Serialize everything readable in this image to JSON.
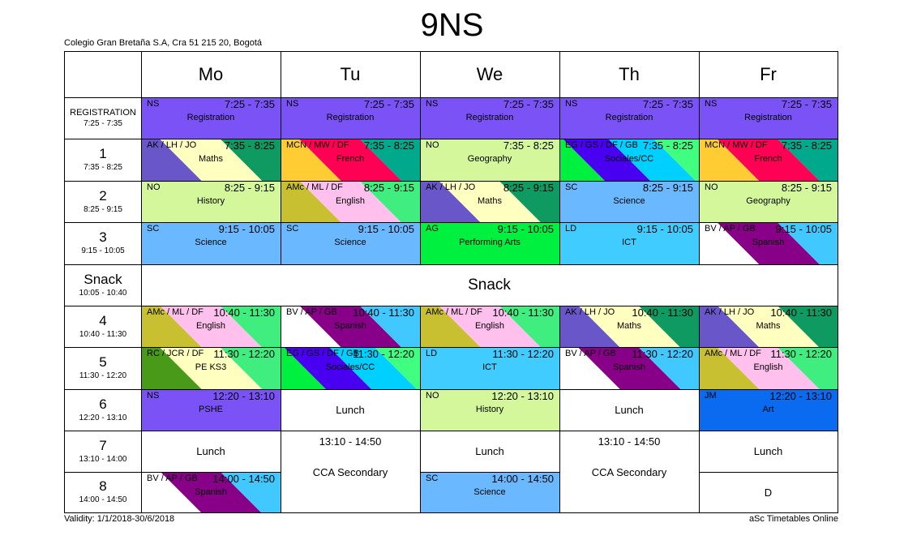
{
  "title": "9NS",
  "school": "Colegio Gran Bretaña S.A, Cra 51 215 20, Bogotá",
  "validity": "Validity: 1/1/2018-30/6/2018",
  "credit": "aSc Timetables Online",
  "days": [
    "Mo",
    "Tu",
    "We",
    "Th",
    "Fr"
  ],
  "periods": [
    {
      "name": "REGISTRATION",
      "time": "7:25 - 7:35"
    },
    {
      "name": "1",
      "time": "7:35 - 8:25"
    },
    {
      "name": "2",
      "time": "8:25 - 9:15"
    },
    {
      "name": "3",
      "time": "9:15 - 10:05"
    },
    {
      "name": "Snack",
      "time": "10:05 - 10:40"
    },
    {
      "name": "4",
      "time": "10:40 - 11:30"
    },
    {
      "name": "5",
      "time": "11:30 - 12:20"
    },
    {
      "name": "6",
      "time": "12:20 - 13:10"
    },
    {
      "name": "7",
      "time": "13:10 - 14:00"
    },
    {
      "name": "8",
      "time": "14:00 - 14:50"
    }
  ],
  "snack_label": "Snack",
  "cells": [
    {
      "day": 0,
      "row": 0,
      "span": 1,
      "kind": "lesson",
      "teacher": "NS",
      "time": "7:25 - 7:35",
      "subject": "Registration",
      "colors": [
        "#7b52f6"
      ]
    },
    {
      "day": 1,
      "row": 0,
      "span": 1,
      "kind": "lesson",
      "teacher": "NS",
      "time": "7:25 - 7:35",
      "subject": "Registration",
      "colors": [
        "#7b52f6"
      ]
    },
    {
      "day": 2,
      "row": 0,
      "span": 1,
      "kind": "lesson",
      "teacher": "NS",
      "time": "7:25 - 7:35",
      "subject": "Registration",
      "colors": [
        "#7b52f6"
      ]
    },
    {
      "day": 3,
      "row": 0,
      "span": 1,
      "kind": "lesson",
      "teacher": "NS",
      "time": "7:25 - 7:35",
      "subject": "Registration",
      "colors": [
        "#7b52f6"
      ]
    },
    {
      "day": 4,
      "row": 0,
      "span": 1,
      "kind": "lesson",
      "teacher": "NS",
      "time": "7:25 - 7:35",
      "subject": "Registration",
      "colors": [
        "#7b52f6"
      ]
    },
    {
      "day": 0,
      "row": 1,
      "span": 1,
      "kind": "lesson",
      "teacher": "AK / LH / JO",
      "time": "7:35 - 8:25",
      "subject": "Maths",
      "colors": [
        "#6957c9",
        "#ffffc0",
        "#0f9a62"
      ]
    },
    {
      "day": 1,
      "row": 1,
      "span": 1,
      "kind": "lesson",
      "teacher": "MCN / MW / DF",
      "time": "7:35 - 8:25",
      "subject": "French",
      "colors": [
        "#ffcc33",
        "#ff0055",
        "#00a88c"
      ]
    },
    {
      "day": 2,
      "row": 1,
      "span": 1,
      "kind": "lesson",
      "teacher": "NO",
      "time": "7:35 - 8:25",
      "subject": "Geography",
      "colors": [
        "#d4f79c"
      ]
    },
    {
      "day": 3,
      "row": 1,
      "span": 1,
      "kind": "lesson",
      "teacher": "EG / GS / DF / GB",
      "time": "7:35 - 8:25",
      "subject": "Sociales/CC",
      "colors": [
        "#00f040",
        "#4a00f0",
        "#00d0ff",
        "#40ff80"
      ]
    },
    {
      "day": 4,
      "row": 1,
      "span": 1,
      "kind": "lesson",
      "teacher": "MCN / MW / DF",
      "time": "7:35 - 8:25",
      "subject": "French",
      "colors": [
        "#ffcc33",
        "#ff0055",
        "#00a88c"
      ]
    },
    {
      "day": 0,
      "row": 2,
      "span": 1,
      "kind": "lesson",
      "teacher": "NO",
      "time": "8:25 - 9:15",
      "subject": "History",
      "colors": [
        "#d4f79c"
      ]
    },
    {
      "day": 1,
      "row": 2,
      "span": 1,
      "kind": "lesson",
      "teacher": "AMc / ML / DF",
      "time": "8:25 - 9:15",
      "subject": "English",
      "colors": [
        "#c8c030",
        "#ffc0ee",
        "#40ee80"
      ]
    },
    {
      "day": 2,
      "row": 2,
      "span": 1,
      "kind": "lesson",
      "teacher": "AK / LH / JO",
      "time": "8:25 - 9:15",
      "subject": "Maths",
      "colors": [
        "#6957c9",
        "#ffffc0",
        "#0f9a62"
      ]
    },
    {
      "day": 3,
      "row": 2,
      "span": 1,
      "kind": "lesson",
      "teacher": "SC",
      "time": "8:25 - 9:15",
      "subject": "Science",
      "colors": [
        "#6ab8ff"
      ]
    },
    {
      "day": 4,
      "row": 2,
      "span": 1,
      "kind": "lesson",
      "teacher": "NO",
      "time": "8:25 - 9:15",
      "subject": "Geography",
      "colors": [
        "#d4f79c"
      ]
    },
    {
      "day": 0,
      "row": 3,
      "span": 1,
      "kind": "lesson",
      "teacher": "SC",
      "time": "9:15 - 10:05",
      "subject": "Science",
      "colors": [
        "#6ab8ff"
      ]
    },
    {
      "day": 1,
      "row": 3,
      "span": 1,
      "kind": "lesson",
      "teacher": "SC",
      "time": "9:15 - 10:05",
      "subject": "Science",
      "colors": [
        "#6ab8ff"
      ]
    },
    {
      "day": 2,
      "row": 3,
      "span": 1,
      "kind": "lesson",
      "teacher": "AG",
      "time": "9:15 - 10:05",
      "subject": "Performing Arts",
      "colors": [
        "#00f040"
      ]
    },
    {
      "day": 3,
      "row": 3,
      "span": 1,
      "kind": "lesson",
      "teacher": "LD",
      "time": "9:15 - 10:05",
      "subject": "ICT",
      "colors": [
        "#40ccff"
      ]
    },
    {
      "day": 4,
      "row": 3,
      "span": 1,
      "kind": "lesson",
      "teacher": "BV / AP / GB",
      "time": "9:15 - 10:05",
      "subject": "Spanish",
      "colors": [
        "#ffffff",
        "#880088",
        "#40c8ff"
      ]
    },
    {
      "day": 0,
      "row": 5,
      "span": 1,
      "kind": "lesson",
      "teacher": "AMc / ML / DF",
      "time": "10:40 - 11:30",
      "subject": "English",
      "colors": [
        "#c8c030",
        "#ffc0ee",
        "#40ee80"
      ]
    },
    {
      "day": 1,
      "row": 5,
      "span": 1,
      "kind": "lesson",
      "teacher": "BV / AP / GB",
      "time": "10:40 - 11:30",
      "subject": "Spanish",
      "colors": [
        "#ffffff",
        "#880088",
        "#40c8ff"
      ]
    },
    {
      "day": 2,
      "row": 5,
      "span": 1,
      "kind": "lesson",
      "teacher": "AMc / ML / DF",
      "time": "10:40 - 11:30",
      "subject": "English",
      "colors": [
        "#c8c030",
        "#ffc0ee",
        "#40ee80"
      ]
    },
    {
      "day": 3,
      "row": 5,
      "span": 1,
      "kind": "lesson",
      "teacher": "AK / LH / JO",
      "time": "10:40 - 11:30",
      "subject": "Maths",
      "colors": [
        "#6957c9",
        "#ffffc0",
        "#0f9a62"
      ]
    },
    {
      "day": 4,
      "row": 5,
      "span": 1,
      "kind": "lesson",
      "teacher": "AK / LH / JO",
      "time": "10:40 - 11:30",
      "subject": "Maths",
      "colors": [
        "#6957c9",
        "#ffffc0",
        "#0f9a62"
      ]
    },
    {
      "day": 0,
      "row": 6,
      "span": 1,
      "kind": "lesson",
      "teacher": "RC / JCR / DF",
      "time": "11:30 - 12:20",
      "subject": "PE KS3",
      "colors": [
        "#4a9a1a",
        "#ffffc0",
        "#40ee80"
      ]
    },
    {
      "day": 1,
      "row": 6,
      "span": 1,
      "kind": "lesson",
      "teacher": "EG / GS / DF / GB",
      "time": "11:30 - 12:20",
      "subject": "Sociales/CC",
      "colors": [
        "#00f040",
        "#4a00f0",
        "#00d0ff",
        "#40ff80"
      ]
    },
    {
      "day": 2,
      "row": 6,
      "span": 1,
      "kind": "lesson",
      "teacher": "LD",
      "time": "11:30 - 12:20",
      "subject": "ICT",
      "colors": [
        "#40ccff"
      ]
    },
    {
      "day": 3,
      "row": 6,
      "span": 1,
      "kind": "lesson",
      "teacher": "BV / AP / GB",
      "time": "11:30 - 12:20",
      "subject": "Spanish",
      "colors": [
        "#ffffff",
        "#880088",
        "#40c8ff"
      ]
    },
    {
      "day": 4,
      "row": 6,
      "span": 1,
      "kind": "lesson",
      "teacher": "AMc / ML / DF",
      "time": "11:30 - 12:20",
      "subject": "English",
      "colors": [
        "#c8c030",
        "#ffc0ee",
        "#40ee80"
      ]
    },
    {
      "day": 0,
      "row": 7,
      "span": 1,
      "kind": "lesson",
      "teacher": "NS",
      "time": "12:20 - 13:10",
      "subject": "PSHE",
      "colors": [
        "#7b52f6"
      ]
    },
    {
      "day": 1,
      "row": 7,
      "span": 1,
      "kind": "plain",
      "text": "Lunch"
    },
    {
      "day": 2,
      "row": 7,
      "span": 1,
      "kind": "lesson",
      "teacher": "NO",
      "time": "12:20 - 13:10",
      "subject": "History",
      "colors": [
        "#d4f79c"
      ]
    },
    {
      "day": 3,
      "row": 7,
      "span": 1,
      "kind": "plain",
      "text": "Lunch"
    },
    {
      "day": 4,
      "row": 7,
      "span": 1,
      "kind": "lesson",
      "teacher": "JM",
      "time": "12:20 - 13:10",
      "subject": "Art",
      "colors": [
        "#0a6af0"
      ]
    },
    {
      "day": 0,
      "row": 8,
      "span": 1,
      "kind": "plain",
      "text": "Lunch"
    },
    {
      "day": 1,
      "row": 8,
      "span": 2,
      "kind": "cca",
      "time": "13:10 - 14:50",
      "text": "CCA Secondary"
    },
    {
      "day": 2,
      "row": 8,
      "span": 1,
      "kind": "plain",
      "text": "Lunch"
    },
    {
      "day": 3,
      "row": 8,
      "span": 2,
      "kind": "cca",
      "time": "13:10 - 14:50",
      "text": "CCA Secondary"
    },
    {
      "day": 4,
      "row": 8,
      "span": 1,
      "kind": "plain",
      "text": "Lunch"
    },
    {
      "day": 0,
      "row": 9,
      "span": 1,
      "kind": "lesson",
      "teacher": "BV / AP / GB",
      "time": "14:00 - 14:50",
      "subject": "Spanish",
      "colors": [
        "#ffffff",
        "#880088",
        "#40c8ff"
      ]
    },
    {
      "day": 2,
      "row": 9,
      "span": 1,
      "kind": "lesson",
      "teacher": "SC",
      "time": "14:00 - 14:50",
      "subject": "Science",
      "colors": [
        "#6ab8ff"
      ]
    },
    {
      "day": 4,
      "row": 9,
      "span": 1,
      "kind": "plain",
      "text": "D"
    }
  ]
}
